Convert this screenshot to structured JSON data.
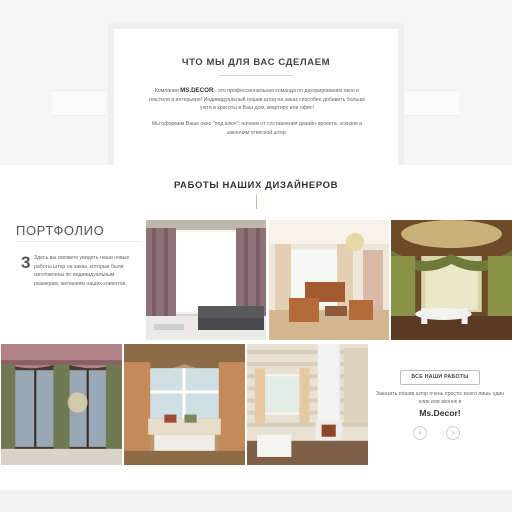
{
  "about": {
    "title": "ЧТО МЫ ДЛЯ ВАС СДЕЛАЕМ",
    "p1_before": "Компания ",
    "p1_brand": "MS.DECOR",
    "p1_after": " - это профессиональная команда по декорированию окон и текстиля в интерьере! Индивидуальный пошив штор на заказ способен добавить больше уюта и красоты в Ваш дом, квартиру или офис!",
    "p2": "Мы оформим Ваше окно \"под ключ\": начнем от составления дизайн-проекта, эскизов и закончим отвеской штор."
  },
  "works": {
    "title": "РАБОТЫ НАШИХ ДИЗАЙНЕРОВ"
  },
  "portfolio": {
    "heading": "ПОРТФОЛИО",
    "number": "3",
    "text": "Здесь вы сможете увидеть наши новые работы штор на заказ, которые были изготовлены по индивидуальным размерам, желаниям наших клиентов."
  },
  "cta": {
    "button_label": "ВСЕ НАШИ РАБОТЫ",
    "text": "Заказать пошив штор очень просто: всего лишь один клик или звонок в",
    "brand": "Ms.Decor!"
  },
  "nav": {
    "prev_icon": "chevron-left-icon",
    "next_icon": "chevron-right-icon"
  },
  "colors": {
    "accent": "#c8b98e",
    "band": "#f6f6f6"
  }
}
